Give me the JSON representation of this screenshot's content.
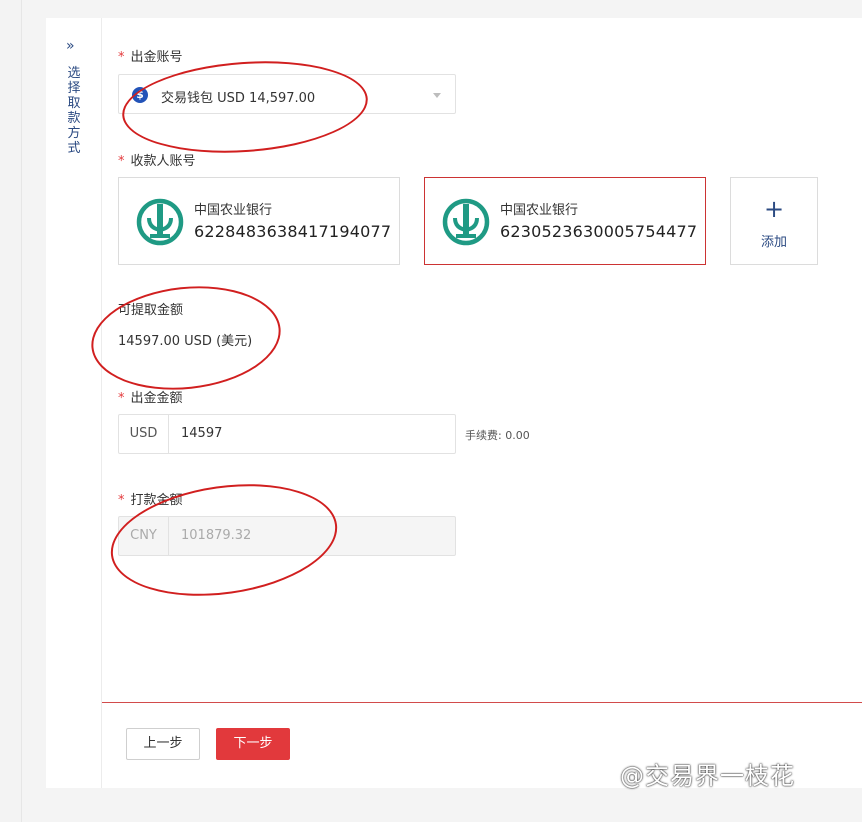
{
  "sidebar": {
    "chevron": "»",
    "label": "选择取款方式"
  },
  "form": {
    "withdraw_account": {
      "required_mark": "*",
      "label": "出金账号",
      "selected": "交易钱包 USD 14,597.00",
      "icon": "dollar-icon"
    },
    "payee_account": {
      "required_mark": "*",
      "label": "收款人账号",
      "cards": [
        {
          "bank": "中国农业银行",
          "number": "6228483638417194077",
          "selected": false
        },
        {
          "bank": "中国农业银行",
          "number": "6230523630005754477",
          "selected": true
        }
      ],
      "add_label": "添加"
    },
    "available": {
      "label": "可提取金额",
      "amount": "14597.00 USD (美元)"
    },
    "withdraw_amount": {
      "required_mark": "*",
      "label": "出金金额",
      "currency": "USD",
      "value": "14597",
      "fee_text": "手续费: 0.00"
    },
    "payment_amount": {
      "required_mark": "*",
      "label": "打款金额",
      "currency": "CNY",
      "value": "101879.32"
    }
  },
  "buttons": {
    "prev": "上一步",
    "next": "下一步"
  },
  "watermark": "@交易界一枝花",
  "colors": {
    "accent_red": "#e2393c",
    "link_blue": "#2b4a82",
    "bank_green": "#1f9a84"
  }
}
